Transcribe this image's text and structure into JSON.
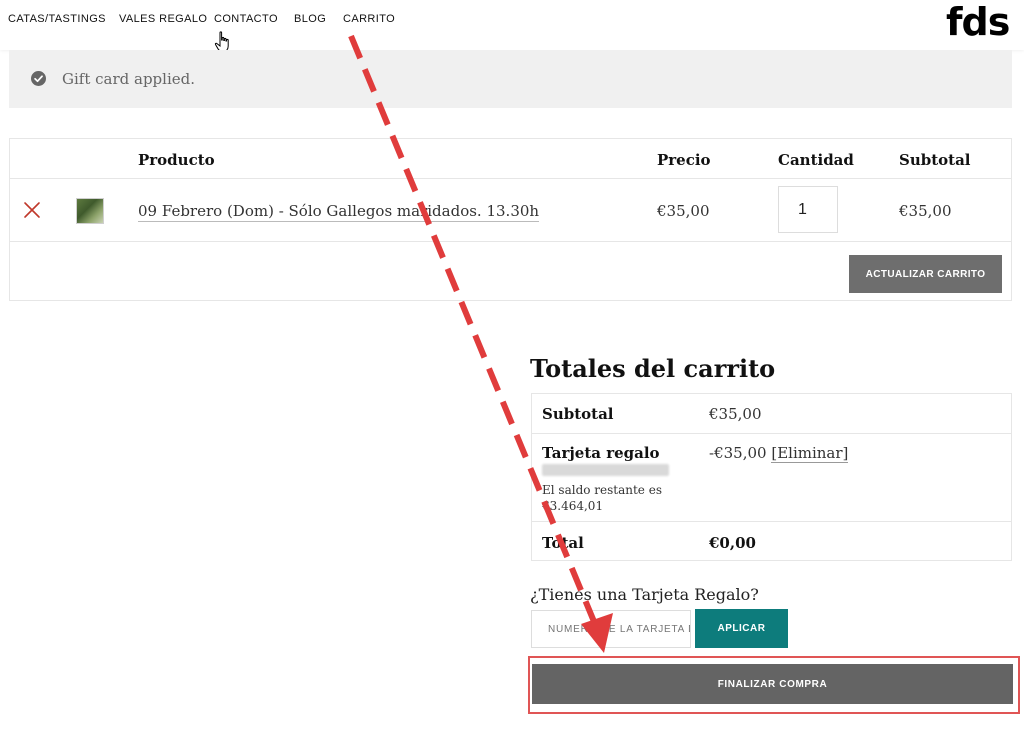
{
  "nav": {
    "items": [
      "CATAS/TASTINGS",
      "VALES REGALO",
      "CONTACTO",
      "BLOG",
      "CARRITO"
    ],
    "logo": "fds"
  },
  "notice": {
    "text": "Gift card applied.",
    "icon": "check-circle-icon"
  },
  "cart": {
    "headers": {
      "product": "Producto",
      "price": "Precio",
      "quantity": "Cantidad",
      "subtotal": "Subtotal"
    },
    "items": [
      {
        "name": "09 Febrero (Dom) - Sólo Gallegos maridados. 13.30h",
        "price": "€35,00",
        "quantity": "1",
        "subtotal": "€35,00"
      }
    ],
    "update_button": "ACTUALIZAR CARRITO"
  },
  "totals": {
    "title": "Totales del carrito",
    "subtotal_label": "Subtotal",
    "subtotal_value": "€35,00",
    "gift_label": "Tarjeta regalo",
    "gift_value": "-€35,00",
    "gift_remove": "[Eliminar]",
    "balance_line1": "El saldo restante es",
    "balance_line2": "€3.464,01",
    "total_label": "Total",
    "total_value": "€0,00"
  },
  "gift_card": {
    "question": "¿Tienes una Tarjeta Regalo?",
    "placeholder": "NÚMERO DE LA TARJETA DE REGALO",
    "apply_button": "APLICAR"
  },
  "checkout": {
    "button": "FINALIZAR COMPRA"
  },
  "colors": {
    "accent": "#0d7c7c",
    "button_gray": "#646464",
    "annotation_red": "#e03c3c"
  }
}
